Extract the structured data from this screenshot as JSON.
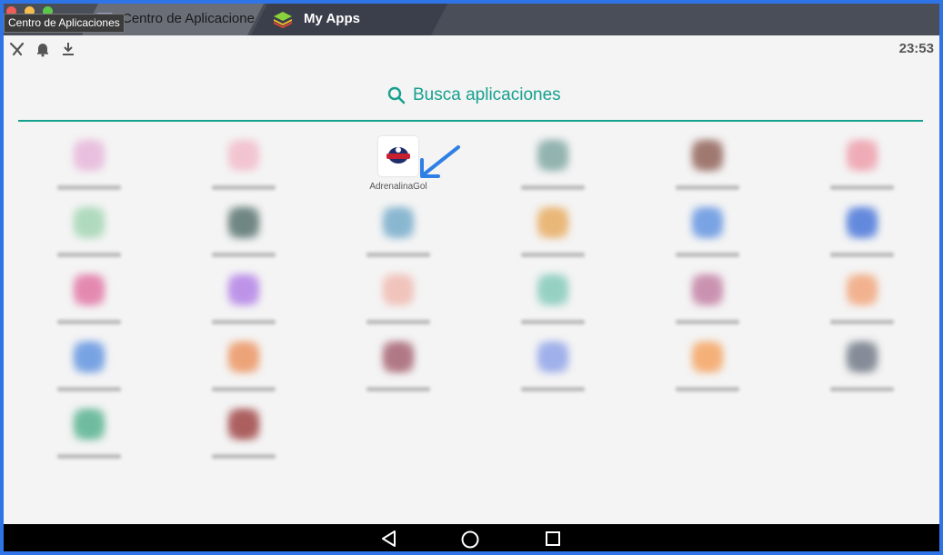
{
  "window": {
    "tooltip": "Centro de Aplicaciones",
    "tabs": [
      {
        "label": "Centro de Aplicaciones",
        "icon": "app-center-icon"
      },
      {
        "label": "My Apps",
        "icon": "bluestacks-layers-icon"
      }
    ]
  },
  "status_bar": {
    "icons": [
      "tools-icon",
      "bell-icon",
      "download-icon"
    ],
    "clock": "23:53"
  },
  "search": {
    "icon": "search-icon",
    "placeholder": "Busca aplicaciones"
  },
  "apps": [
    {
      "label": "",
      "color": "#e6b3d9"
    },
    {
      "label": "",
      "color": "#f2b9c8"
    },
    {
      "label": "AdrenalinaGol",
      "color": "#ffffff"
    },
    {
      "label": "",
      "color": "#7aa39e"
    },
    {
      "label": "",
      "color": "#8b5a50"
    },
    {
      "label": "",
      "color": "#ee9aa8"
    },
    {
      "label": "",
      "color": "#9fd4b0"
    },
    {
      "label": "",
      "color": "#4f6b66"
    },
    {
      "label": "",
      "color": "#6fa8c8"
    },
    {
      "label": "",
      "color": "#e7a85a"
    },
    {
      "label": "",
      "color": "#5b8fe0"
    },
    {
      "label": "",
      "color": "#3f6fd8"
    },
    {
      "label": "",
      "color": "#e06fa0"
    },
    {
      "label": "",
      "color": "#b07ce6"
    },
    {
      "label": "",
      "color": "#f0b7ad"
    },
    {
      "label": "",
      "color": "#7fc8b8"
    },
    {
      "label": "",
      "color": "#c07aa0"
    },
    {
      "label": "",
      "color": "#f2a277"
    },
    {
      "label": "",
      "color": "#5a8fe0"
    },
    {
      "label": "",
      "color": "#ec8f5a"
    },
    {
      "label": "",
      "color": "#a05a6a"
    },
    {
      "label": "",
      "color": "#8ba0e8"
    },
    {
      "label": "",
      "color": "#f5a05a"
    },
    {
      "label": "",
      "color": "#6a7280"
    },
    {
      "label": "",
      "color": "#4fae8a"
    },
    {
      "label": "",
      "color": "#9a3a3a"
    }
  ],
  "highlight": {
    "target": "AdrenalinaGol",
    "arrow_color": "#2f7fe6"
  },
  "nav": [
    "back-icon",
    "home-icon",
    "recents-icon"
  ]
}
